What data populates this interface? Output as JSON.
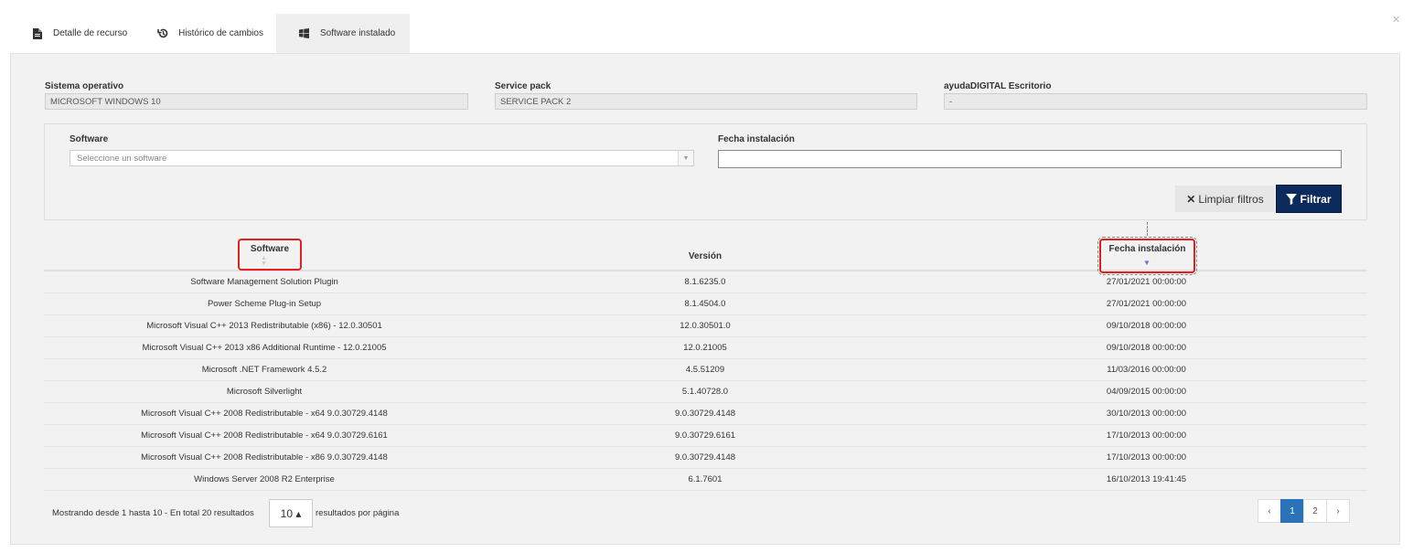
{
  "tabs": [
    {
      "label": "Detalle de recurso",
      "icon": "document-icon"
    },
    {
      "label": "Histórico de cambios",
      "icon": "history-icon"
    },
    {
      "label": "Software instalado",
      "icon": "windows-icon",
      "active": true
    }
  ],
  "close_label": "×",
  "info": {
    "os_label": "Sistema operativo",
    "os_value": "MICROSOFT WINDOWS 10",
    "sp_label": "Service pack",
    "sp_value": "SERVICE PACK 2",
    "ad_label": "ayudaDIGITAL Escritorio",
    "ad_value": "-"
  },
  "filters": {
    "software_label": "Software",
    "software_placeholder": "Seleccione un software",
    "date_label": "Fecha instalación",
    "date_value": "",
    "clear_label": "Limpiar filtros",
    "filter_label": "Filtrar"
  },
  "table": {
    "columns": [
      "Software",
      "Versión",
      "Fecha instalación"
    ],
    "rows": [
      [
        "Software Management Solution Plugin",
        "8.1.6235.0",
        "27/01/2021 00:00:00"
      ],
      [
        "Power Scheme Plug-in Setup",
        "8.1.4504.0",
        "27/01/2021 00:00:00"
      ],
      [
        "Microsoft Visual C++ 2013 Redistributable (x86) - 12.0.30501",
        "12.0.30501.0",
        "09/10/2018 00:00:00"
      ],
      [
        "Microsoft Visual C++ 2013 x86 Additional Runtime - 12.0.21005",
        "12.0.21005",
        "09/10/2018 00:00:00"
      ],
      [
        "Microsoft .NET Framework 4.5.2",
        "4.5.51209",
        "11/03/2016 00:00:00"
      ],
      [
        "Microsoft Silverlight",
        "5.1.40728.0",
        "04/09/2015 00:00:00"
      ],
      [
        "Microsoft Visual C++ 2008 Redistributable - x64 9.0.30729.4148",
        "9.0.30729.4148",
        "30/10/2013 00:00:00"
      ],
      [
        "Microsoft Visual C++ 2008 Redistributable - x64 9.0.30729.6161",
        "9.0.30729.6161",
        "17/10/2013 00:00:00"
      ],
      [
        "Microsoft Visual C++ 2008 Redistributable - x86 9.0.30729.4148",
        "9.0.30729.4148",
        "17/10/2013 00:00:00"
      ],
      [
        "Windows Server 2008 R2 Enterprise",
        "6.1.7601",
        "16/10/2013 19:41:45"
      ]
    ]
  },
  "footer": {
    "showing": "Mostrando desde 1 hasta 10 - En total 20 resultados",
    "page_size": "10 ▴",
    "per_page": "resultados por página",
    "pages": [
      "‹",
      "1",
      "2",
      "›"
    ],
    "current_page": "1"
  },
  "colors": {
    "accent": "#0d2a5c",
    "page_active": "#2a73b8",
    "highlight": "#e02020"
  }
}
